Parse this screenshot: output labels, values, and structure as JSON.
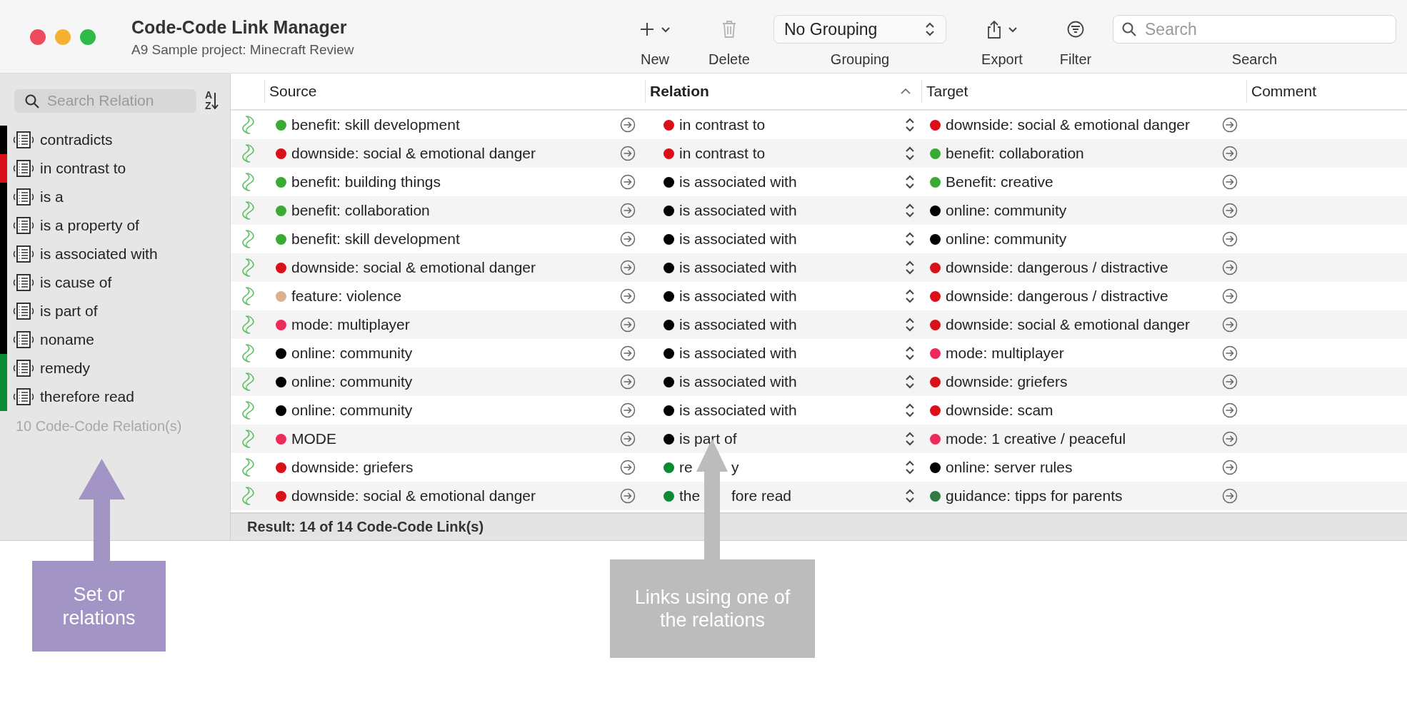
{
  "window": {
    "title": "Code-Code Link Manager",
    "subtitle": "A9 Sample project: Minecraft Review"
  },
  "toolbar": [
    {
      "kind": "add",
      "label": "New",
      "disabled": false
    },
    {
      "kind": "trash",
      "label": "Delete",
      "disabled": true
    },
    {
      "kind": "popup",
      "value": "No Grouping",
      "label": "Grouping"
    },
    {
      "kind": "share",
      "label": "Export",
      "disabled": false
    },
    {
      "kind": "filter",
      "label": "Filter",
      "disabled": false
    },
    {
      "kind": "search",
      "placeholder": "Search",
      "label": "Search"
    }
  ],
  "sidebar": {
    "search": {
      "placeholder": "Search Relation"
    },
    "sort_button": {
      "label": "AZ"
    },
    "items": [
      {
        "label": "contradicts",
        "color": "#000000"
      },
      {
        "label": "in contrast to",
        "color": "#d9101a"
      },
      {
        "label": "is a",
        "color": "#000000"
      },
      {
        "label": "is a property of",
        "color": "#000000"
      },
      {
        "label": "is associated with",
        "color": "#000000"
      },
      {
        "label": "is cause of",
        "color": "#000000"
      },
      {
        "label": "is part of",
        "color": "#000000"
      },
      {
        "label": "noname",
        "color": "#000000"
      },
      {
        "label": "remedy",
        "color": "#0a8a35"
      },
      {
        "label": "therefore read",
        "color": "#0a8a35"
      }
    ],
    "count": "10 Code-Code Relation(s)"
  },
  "table": {
    "columns": [
      {
        "label": "Source",
        "sorted": false
      },
      {
        "label": "Relation",
        "sorted": true
      },
      {
        "label": "Target",
        "sorted": false
      },
      {
        "label": "Comment",
        "sorted": false
      }
    ],
    "rows": [
      {
        "source": {
          "label": "benefit: skill development",
          "color": "#3aaa35"
        },
        "relation": {
          "label": "in contrast to",
          "color": "#d9101a"
        },
        "target": {
          "label": "downside: social & emotional danger",
          "color": "#d9101a"
        }
      },
      {
        "source": {
          "label": "downside: social & emotional danger",
          "color": "#d9101a"
        },
        "relation": {
          "label": "in contrast to",
          "color": "#d9101a"
        },
        "target": {
          "label": "benefit: collaboration",
          "color": "#3aaa35"
        }
      },
      {
        "source": {
          "label": "benefit: building things",
          "color": "#3aaa35"
        },
        "relation": {
          "label": "is associated with",
          "color": "#000000"
        },
        "target": {
          "label": "Benefit: creative",
          "color": "#3aaa35"
        }
      },
      {
        "source": {
          "label": "benefit: collaboration",
          "color": "#3aaa35"
        },
        "relation": {
          "label": "is associated with",
          "color": "#000000"
        },
        "target": {
          "label": "online: community",
          "color": "#000000"
        }
      },
      {
        "source": {
          "label": "benefit: skill development",
          "color": "#3aaa35"
        },
        "relation": {
          "label": "is associated with",
          "color": "#000000"
        },
        "target": {
          "label": "online: community",
          "color": "#000000"
        }
      },
      {
        "source": {
          "label": "downside: social & emotional danger",
          "color": "#d9101a"
        },
        "relation": {
          "label": "is associated with",
          "color": "#000000"
        },
        "target": {
          "label": "downside: dangerous / distractive",
          "color": "#d9101a"
        }
      },
      {
        "source": {
          "label": "feature: violence",
          "color": "#d9b38c"
        },
        "relation": {
          "label": "is associated with",
          "color": "#000000"
        },
        "target": {
          "label": "downside: dangerous / distractive",
          "color": "#d9101a"
        }
      },
      {
        "source": {
          "label": "mode: multiplayer",
          "color": "#ec2a5c"
        },
        "relation": {
          "label": "is associated with",
          "color": "#000000"
        },
        "target": {
          "label": "downside: social & emotional danger",
          "color": "#d9101a"
        }
      },
      {
        "source": {
          "label": "online: community",
          "color": "#000000"
        },
        "relation": {
          "label": "is associated with",
          "color": "#000000"
        },
        "target": {
          "label": "mode: multiplayer",
          "color": "#ec2a5c"
        }
      },
      {
        "source": {
          "label": "online: community",
          "color": "#000000"
        },
        "relation": {
          "label": "is associated with",
          "color": "#000000"
        },
        "target": {
          "label": "downside: griefers",
          "color": "#d9101a"
        }
      },
      {
        "source": {
          "label": "online: community",
          "color": "#000000"
        },
        "relation": {
          "label": "is associated with",
          "color": "#000000"
        },
        "target": {
          "label": "downside: scam",
          "color": "#d9101a"
        }
      },
      {
        "source": {
          "label": "MODE",
          "color": "#ec2a5c"
        },
        "relation": {
          "label": "is part of",
          "color": "#000000"
        },
        "target": {
          "label": "mode: 1 creative / peaceful",
          "color": "#ec2a5c"
        }
      },
      {
        "source": {
          "label": "downside: griefers",
          "color": "#d9101a"
        },
        "relation": {
          "parts": [
            "re",
            "y"
          ],
          "color": "#0a8a35"
        },
        "target": {
          "label": "online: server rules",
          "color": "#000000"
        }
      },
      {
        "source": {
          "label": "downside: social & emotional danger",
          "color": "#d9101a"
        },
        "relation": {
          "parts": [
            "the",
            "fore read"
          ],
          "color": "#0a8a35"
        },
        "target": {
          "label": "guidance: tipps for parents",
          "color": "#2f7a45"
        }
      }
    ],
    "status": "Result: 14 of 14 Code-Code Link(s)"
  },
  "annotations": [
    {
      "text": "Set or relations",
      "color": "#a394c6"
    },
    {
      "text": "Links using one of the relations",
      "color": "#bcbcbc"
    }
  ]
}
